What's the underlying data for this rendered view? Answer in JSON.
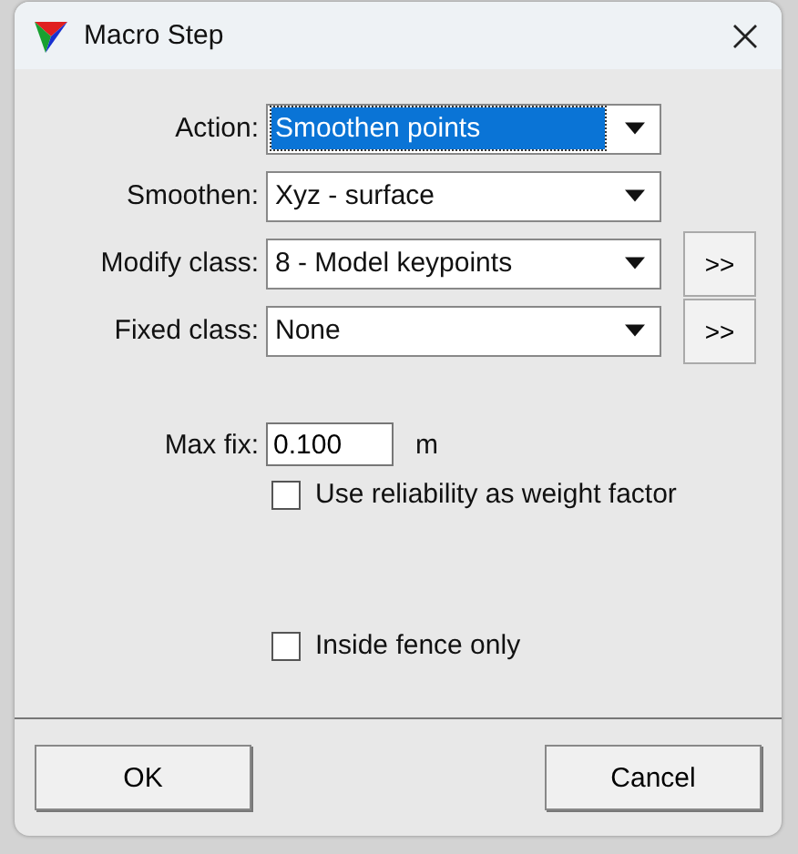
{
  "window": {
    "title": "Macro Step"
  },
  "fields": [
    {
      "label": "Action:",
      "value": "Smoothen points",
      "highlighted": true
    },
    {
      "label": "Smoothen:",
      "value": "Xyz - surface",
      "highlighted": false
    },
    {
      "label": "Modify class:",
      "value": "8 - Model keypoints",
      "highlighted": false,
      "extra_button": ">>"
    },
    {
      "label": "Fixed class:",
      "value": "None",
      "highlighted": false,
      "extra_button": ">>"
    }
  ],
  "max_fix": {
    "label": "Max fix:",
    "value": "0.100",
    "unit": "m"
  },
  "checkboxes": [
    {
      "label": "Use reliability as weight factor",
      "checked": false
    },
    {
      "label": "Inside fence only",
      "checked": false
    }
  ],
  "buttons": [
    "OK",
    "Cancel"
  ]
}
